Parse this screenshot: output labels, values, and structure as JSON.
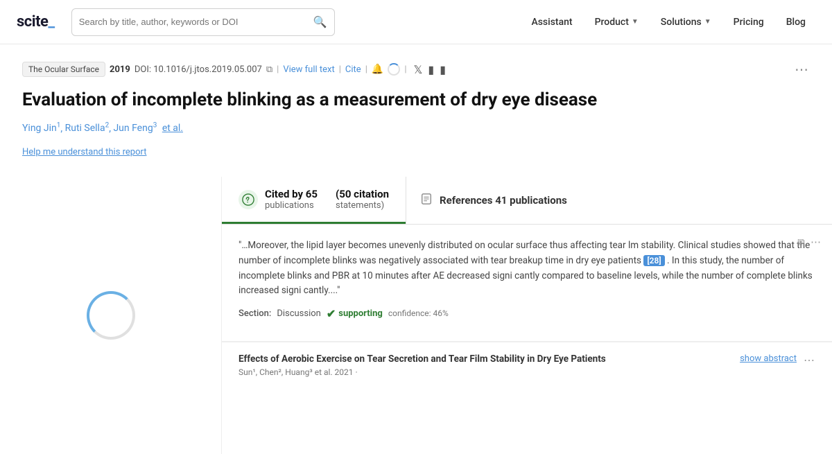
{
  "navbar": {
    "logo": "scite_",
    "search_placeholder": "Search by title, author, keywords or DOI",
    "nav_items": [
      {
        "label": "Assistant",
        "has_dropdown": false
      },
      {
        "label": "Product",
        "has_dropdown": true
      },
      {
        "label": "Solutions",
        "has_dropdown": true
      },
      {
        "label": "Pricing",
        "has_dropdown": false
      },
      {
        "label": "Blog",
        "has_dropdown": false
      }
    ]
  },
  "paper": {
    "journal": "The Ocular Surface",
    "year": "2019",
    "doi_label": "DOI:",
    "doi_value": "10.1016/j.jtos.2019.05.007",
    "view_full_text": "View full text",
    "cite": "Cite",
    "title": "Evaluation of incomplete blinking as a measurement of dry eye disease",
    "authors": [
      {
        "name": "Ying Jin",
        "sup": "1"
      },
      {
        "name": "Ruti Sella",
        "sup": "2"
      },
      {
        "name": "Jun Feng",
        "sup": "3"
      }
    ],
    "et_al": "et al.",
    "help_link": "Help me understand this report"
  },
  "tabs": {
    "cited_by_label": "Cited by 65 publications",
    "cited_by_main": "Cited by 65",
    "cited_by_sub": "publications",
    "citation_statements_label": "(50 citation statements)",
    "citation_main": "(50 citation",
    "citation_sub": "statements)",
    "references_label": "References 41 publications",
    "references_main": "References 41 publications"
  },
  "citation_card": {
    "quote": "\"…Moreover, the lipid layer becomes unevenly distributed on ocular surface thus affecting tear lm stability. Clinical studies showed that the number of incomplete blinks was negatively associated with tear breakup time in dry eye patients",
    "cite_num": "[28]",
    "quote_rest": ". In this study, the number of incomplete blinks and PBR at 10 minutes after AE decreased signi cantly compared to baseline levels, while the number of complete blinks increased signi cantly....\"",
    "section_label": "Section:",
    "section_name": "Discussion",
    "supporting_label": "supporting",
    "confidence_label": "confidence: 46%"
  },
  "paper_ref": {
    "title": "Effects of Aerobic Exercise on Tear Secretion and Tear Film Stability in Dry Eye Patients",
    "authors_partial": "Sun¹, Chen², Huang³ et al. 2021 ·",
    "show_abstract": "show abstract"
  },
  "colors": {
    "brand_blue": "#4a90d9",
    "brand_green": "#2e7d32",
    "accent_light": "#6ab0e4"
  }
}
